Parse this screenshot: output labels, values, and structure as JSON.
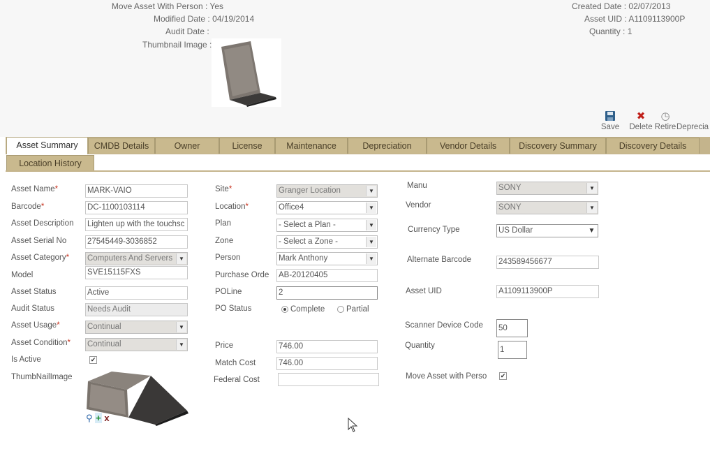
{
  "header": {
    "left": [
      {
        "label": "Move Asset With Person :",
        "value": "Yes"
      },
      {
        "label": "Modified Date :",
        "value": "04/19/2014"
      },
      {
        "label": "Audit Date :",
        "value": ""
      },
      {
        "label": "Thumbnail Image :",
        "value": ""
      }
    ],
    "right": [
      {
        "label": "Created Date :",
        "value": "02/07/2013"
      },
      {
        "label": "Asset UID :",
        "value": "A1109113900P"
      },
      {
        "label": "Quantity :",
        "value": "1"
      }
    ]
  },
  "toolbar": {
    "save": {
      "label": "Save",
      "icon": "floppy-icon"
    },
    "delete": {
      "label": "Delete",
      "icon": "x-icon"
    },
    "retire": {
      "label": "Retire",
      "icon": "clock-icon"
    },
    "depreciate": {
      "label": "Deprecia",
      "icon": "none"
    }
  },
  "tabs": {
    "row1": [
      "Asset Summary",
      "CMDB Details",
      "Owner",
      "License",
      "Maintenance",
      "Depreciation",
      "Vendor Details",
      "Discovery Summary",
      "Discovery Details"
    ],
    "row2": [
      "Location History"
    ],
    "active": "Asset Summary"
  },
  "col1": {
    "asset_name": {
      "label": "Asset Name",
      "value": "MARK-VAIO"
    },
    "barcode": {
      "label": "Barcode",
      "value": "DC-1100103114"
    },
    "asset_description": {
      "label": "Asset Description",
      "value": "Lighten up with the touchsc"
    },
    "asset_serial_no": {
      "label": "Asset Serial No",
      "value": "27545449-3036852"
    },
    "asset_category": {
      "label": "Asset Category",
      "value": "Computers And Servers"
    },
    "model": {
      "label": "Model",
      "value": "SVE15115FXS"
    },
    "asset_status": {
      "label": "Asset Status",
      "value": "Active"
    },
    "audit_status": {
      "label": "Audit Status",
      "value": "Needs Audit"
    },
    "asset_usage": {
      "label": "Asset Usage",
      "value": "Continual"
    },
    "asset_condition": {
      "label": "Asset Condition",
      "value": "Continual"
    },
    "is_active": {
      "label": "Is Active",
      "checked": true
    },
    "thumbnail": {
      "label": "ThumbNailImage"
    }
  },
  "col2": {
    "site": {
      "label": "Site",
      "value": "Granger Location"
    },
    "location": {
      "label": "Location",
      "value": "Office4"
    },
    "plan": {
      "label": "Plan",
      "value": "- Select a Plan -"
    },
    "zone": {
      "label": "Zone",
      "value": "- Select a Zone -"
    },
    "person": {
      "label": "Person",
      "value": "Mark Anthony"
    },
    "purchase_order": {
      "label": "Purchase Orde",
      "value": "AB-20120405"
    },
    "poline": {
      "label": "POLine",
      "value": "2"
    },
    "po_status": {
      "label": "PO Status",
      "options": [
        "Complete",
        "Partial"
      ],
      "selected": "Complete"
    },
    "price": {
      "label": "Price",
      "value": "746.00"
    },
    "match_cost": {
      "label": "Match Cost",
      "value": "746.00"
    },
    "federal_cost": {
      "label": "Federal Cost",
      "value": ""
    }
  },
  "col3": {
    "manu": {
      "label": "Manu",
      "value": "SONY"
    },
    "vendor": {
      "label": "Vendor",
      "value": "SONY"
    },
    "currency_type": {
      "label": "Currency Type",
      "value": "US Dollar"
    },
    "alternate_barcode": {
      "label": "Alternate Barcode",
      "value": "243589456677"
    },
    "asset_uid": {
      "label": "Asset UID",
      "value": "A1109113900P"
    },
    "scanner_device_code": {
      "label": "Scanner Device Code",
      "value": "50"
    },
    "quantity": {
      "label": "Quantity",
      "value": "1"
    },
    "move_asset": {
      "label": "Move Asset with Perso",
      "checked": true
    }
  },
  "colors": {
    "tab_bg": "#c9b98e",
    "tab_border": "#a89a72",
    "required": "#c8321e",
    "delete_red": "#c0201a",
    "save_blue": "#2f5f8a"
  }
}
